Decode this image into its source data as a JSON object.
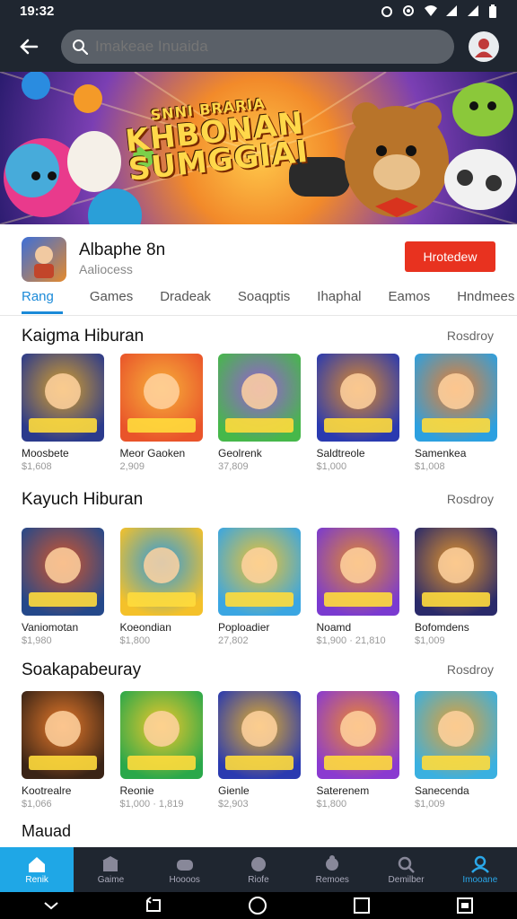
{
  "status": {
    "time": "19:32"
  },
  "appbar": {
    "search_placeholder": "Imakeae Inuaida"
  },
  "banner": {
    "title_line1": "SNNI BRARIA",
    "title_line2": "KHBONAN",
    "title_line3": "SUMGGIAI"
  },
  "app": {
    "name": "Albaphe 8n",
    "subtitle": "Aaliocess",
    "install_label": "Hrotedew",
    "tabs": [
      "Rang",
      "Games",
      "Dradeak",
      "Soaqptis",
      "Ihaphal",
      "Eamos",
      "Hndmees"
    ]
  },
  "sections": [
    {
      "title": "Kaigma Hiburan",
      "more": "Rosdroy",
      "games": [
        {
          "name": "Moosbete",
          "size": "$1,608",
          "color1": "#2b3a8c",
          "color2": "#d9a12a"
        },
        {
          "name": "Meor Gaoken",
          "size": "2,909",
          "color1": "#e9542a",
          "color2": "#f7b13a"
        },
        {
          "name": "Geolrenk",
          "size": "37,809",
          "color1": "#46b84a",
          "color2": "#9a5bd6"
        },
        {
          "name": "Saldtreole",
          "size": "$1,000",
          "color1": "#2a3ab0",
          "color2": "#e08c2a"
        },
        {
          "name": "Samenkea",
          "size": "$1,008",
          "color1": "#2ca0e0",
          "color2": "#ef7d2a"
        }
      ]
    },
    {
      "title": "Kayuch Hiburan",
      "more": "Rosdroy",
      "games": [
        {
          "name": "Vaniomotan",
          "size": "$1,980",
          "color1": "#24488a",
          "color2": "#d4562a"
        },
        {
          "name": "Koeondian",
          "size": "$1,800",
          "color1": "#f4c12a",
          "color2": "#2c9ae0"
        },
        {
          "name": "Poploadier",
          "size": "27,802",
          "color1": "#3aa6e2",
          "color2": "#f1c32e"
        },
        {
          "name": "Noamd",
          "size": "$1,900 · 21,810",
          "color1": "#7a3ad0",
          "color2": "#e58b2a"
        },
        {
          "name": "Bofomdens",
          "size": "$1,009",
          "color1": "#2a2a6a",
          "color2": "#e6962a"
        }
      ]
    },
    {
      "title": "Soakapabeuray",
      "more": "Rosdroy",
      "games": [
        {
          "name": "Kootrealre",
          "size": "$1,066",
          "color1": "#3a2416",
          "color2": "#e87a2a"
        },
        {
          "name": "Reonie",
          "size": "$1,000 · 1,819",
          "color1": "#2aa84a",
          "color2": "#f2c82a"
        },
        {
          "name": "Gienle",
          "size": "$2,903",
          "color1": "#2a3ab0",
          "color2": "#e6b02a"
        },
        {
          "name": "Saterenem",
          "size": "$1,800",
          "color1": "#8a3ad0",
          "color2": "#f08a2a"
        },
        {
          "name": "Sanecenda",
          "size": "$1,009",
          "color1": "#3ab0e0",
          "color2": "#e8a030"
        }
      ]
    }
  ],
  "bottom_section_title": "Mauad",
  "nav": [
    {
      "label": "Renik",
      "icon": "home-icon"
    },
    {
      "label": "Gaime",
      "icon": "store-icon"
    },
    {
      "label": "Hoooos",
      "icon": "controller-icon"
    },
    {
      "label": "Riofe",
      "icon": "face-icon"
    },
    {
      "label": "Remoes",
      "icon": "puzzle-icon"
    },
    {
      "label": "Demilber",
      "icon": "search-icon"
    },
    {
      "label": "Imooane",
      "icon": "profile-icon"
    }
  ]
}
